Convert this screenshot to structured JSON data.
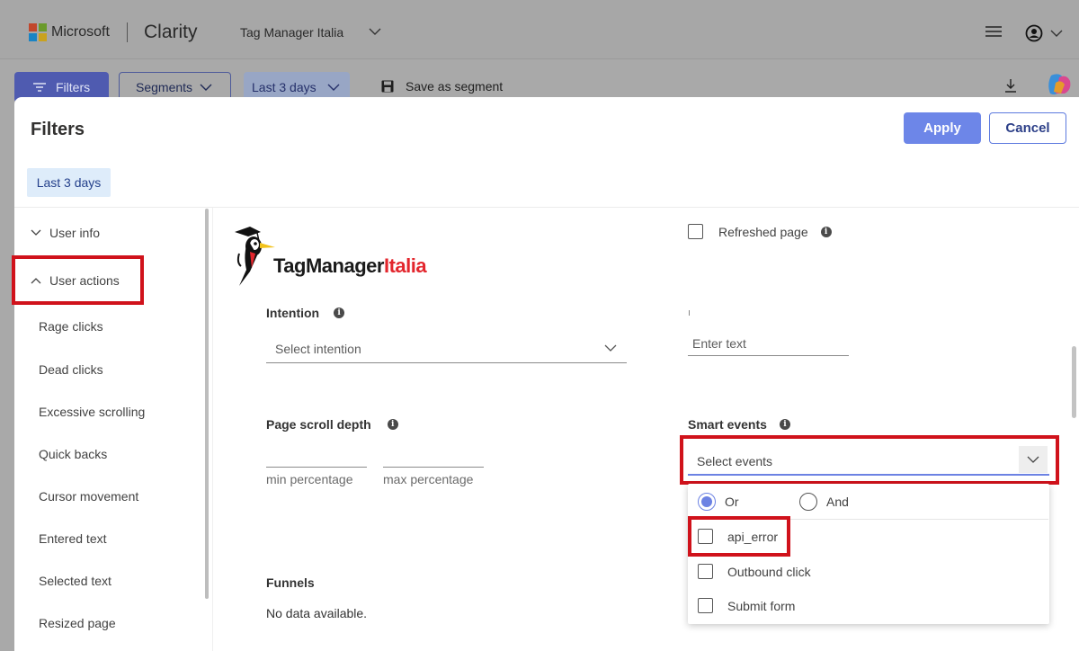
{
  "topbar": {
    "brand": "Microsoft",
    "product": "Clarity",
    "project": "Tag Manager Italia"
  },
  "toolbar": {
    "filters_label": "Filters",
    "segments_label": "Segments",
    "date_label": "Last 3 days",
    "save_segment_label": "Save as segment"
  },
  "panel": {
    "title": "Filters",
    "apply_label": "Apply",
    "cancel_label": "Cancel",
    "date_chip": "Last 3 days"
  },
  "sidebar": {
    "user_info": "User info",
    "user_actions": "User actions",
    "items": [
      "Rage clicks",
      "Dead clicks",
      "Excessive scrolling",
      "Quick backs",
      "Cursor movement",
      "Entered text",
      "Selected text",
      "Resized page"
    ]
  },
  "logo": {
    "text_dark": "TagManager",
    "text_red": "Italia"
  },
  "form": {
    "refreshed_page": "Refreshed page",
    "intention_label": "Intention",
    "intention_placeholder": "Select intention",
    "text_placeholder": "Enter text",
    "scroll_depth_label": "Page scroll depth",
    "min_percentage": "min percentage",
    "max_percentage": "max percentage",
    "smart_events_label": "Smart events",
    "events_placeholder": "Select events",
    "funnels_label": "Funnels",
    "funnels_empty": "No data available."
  },
  "dropdown": {
    "or_label": "Or",
    "and_label": "And",
    "options": [
      "api_error",
      "Outbound click",
      "Submit form"
    ]
  },
  "colors": {
    "accent": "#6d86e8",
    "annotation_red": "#d0121b",
    "logo_red": "#e3262d"
  }
}
